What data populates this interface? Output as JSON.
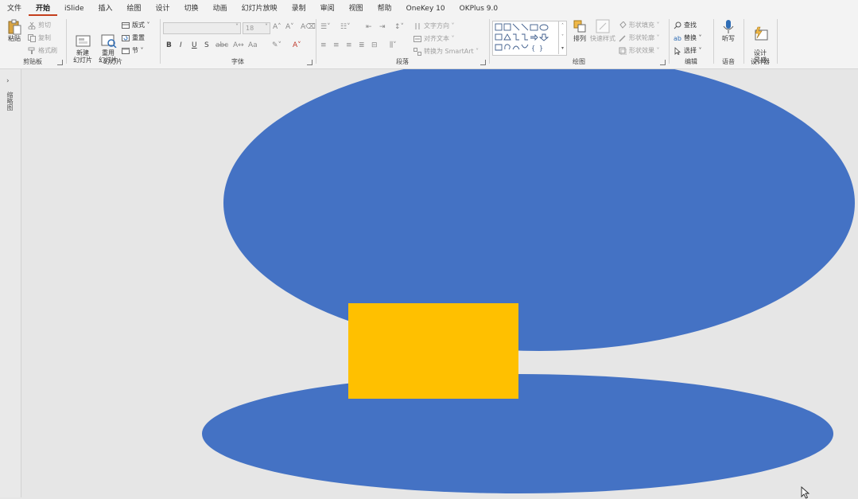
{
  "tabs": [
    {
      "label": "文件",
      "active": false
    },
    {
      "label": "开始",
      "active": true
    },
    {
      "label": "iSlide",
      "active": false
    },
    {
      "label": "插入",
      "active": false
    },
    {
      "label": "绘图",
      "active": false
    },
    {
      "label": "设计",
      "active": false
    },
    {
      "label": "切换",
      "active": false
    },
    {
      "label": "动画",
      "active": false
    },
    {
      "label": "幻灯片放映",
      "active": false
    },
    {
      "label": "录制",
      "active": false
    },
    {
      "label": "审阅",
      "active": false
    },
    {
      "label": "视图",
      "active": false
    },
    {
      "label": "帮助",
      "active": false
    },
    {
      "label": "OneKey 10",
      "active": false
    },
    {
      "label": "OKPlus 9.0",
      "active": false
    }
  ],
  "clipboard": {
    "paste": "粘贴",
    "cut": "剪切",
    "copy": "复制",
    "format_painter": "格式刷",
    "label": "剪贴板"
  },
  "slides": {
    "new_slide": "新建\n幻灯片",
    "reuse_slide": "重用\n幻灯片",
    "layout": "版式",
    "reset": "重置",
    "section": "节",
    "label": "幻灯片"
  },
  "font": {
    "font_name": "",
    "font_size": "18",
    "label": "字体",
    "bold": "B",
    "italic": "I",
    "underline": "U",
    "strike": "S",
    "shadow": "abc",
    "case": "Aa"
  },
  "paragraph": {
    "text_direction": "文字方向",
    "align_text": "对齐文本",
    "smartart": "转换为 SmartArt",
    "label": "段落"
  },
  "drawing": {
    "arrange": "排列",
    "quick_styles": "快速样式",
    "shape_fill": "形状填充",
    "shape_outline": "形状轮廓",
    "shape_effects": "形状效果",
    "label": "绘图"
  },
  "editing": {
    "find": "查找",
    "replace": "替换",
    "select": "选择",
    "label": "编辑"
  },
  "voice": {
    "dictate": "听写",
    "label": "语音"
  },
  "designer": {
    "design_ideas": "设计\n灵感",
    "label": "设计器"
  },
  "left_panel": {
    "thumbnails": "缩略图"
  },
  "colors": {
    "shape_blue": "#4472c4",
    "shape_gold": "#ffc000",
    "accent": "#c43e1c",
    "ribbon_bg": "#f3f3f3",
    "canvas_bg": "#e6e6e6"
  }
}
